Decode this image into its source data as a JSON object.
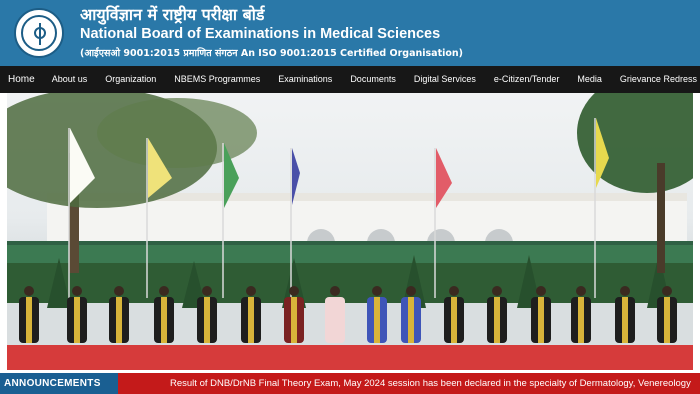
{
  "header": {
    "hindi_title": "आयुर्विज्ञान में राष्ट्रीय परीक्षा बोर्ड",
    "english_title": "National Board of Examinations in Medical Sciences",
    "iso_line": "(आईएसओ 9001:2015 प्रमाणित संगठन An ISO 9001:2015 Certified Organisation)",
    "logo_icon": "nbems-emblem-icon"
  },
  "nav": {
    "items": [
      {
        "label": "Home"
      },
      {
        "label": "About us"
      },
      {
        "label": "Organization"
      },
      {
        "label": "NBEMS Programmes"
      },
      {
        "label": "Examinations"
      },
      {
        "label": "Documents"
      },
      {
        "label": "Digital Services"
      },
      {
        "label": "e-Citizen/Tender"
      },
      {
        "label": "Media"
      },
      {
        "label": "Grievance Redress"
      }
    ]
  },
  "announcements": {
    "label": "ANNOUNCEMENTS",
    "ticker": "Result of DNB/DrNB Final Theory Exam, May 2024 session has been declared in the specialty of Dermatology, Venereology"
  },
  "colors": {
    "header_bg": "#2a78a8",
    "nav_bg": "#171717",
    "announce_label_bg": "#1a5f92",
    "announce_bar_bg": "#c41a1a"
  }
}
